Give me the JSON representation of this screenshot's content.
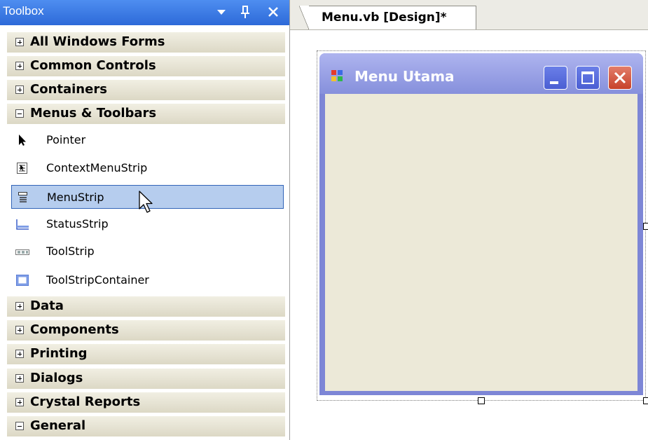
{
  "toolbox": {
    "title": "Toolbox",
    "buttons": {
      "dropdown": "▾",
      "pin": "ᵻ",
      "close": "✕"
    },
    "categories_top": [
      {
        "label": "All Windows Forms",
        "expanded": false
      },
      {
        "label": "Common Controls",
        "expanded": false
      },
      {
        "label": "Containers",
        "expanded": false
      },
      {
        "label": "Menus & Toolbars",
        "expanded": true
      }
    ],
    "items": [
      {
        "label": "Pointer",
        "icon": "pointer-icon"
      },
      {
        "label": "ContextMenuStrip",
        "icon": "contextmenustrip-icon"
      },
      {
        "label": "MenuStrip",
        "icon": "menustrip-icon",
        "selected": true
      },
      {
        "label": "StatusStrip",
        "icon": "statusstrip-icon"
      },
      {
        "label": "ToolStrip",
        "icon": "toolstrip-icon"
      },
      {
        "label": "ToolStripContainer",
        "icon": "toolstripcontainer-icon"
      }
    ],
    "categories_bottom": [
      {
        "label": "Data",
        "expanded": false
      },
      {
        "label": "Components",
        "expanded": false
      },
      {
        "label": "Printing",
        "expanded": false
      },
      {
        "label": "Dialogs",
        "expanded": false
      },
      {
        "label": "Crystal Reports",
        "expanded": false
      },
      {
        "label": "General",
        "expanded": true
      }
    ]
  },
  "editor": {
    "tab_label": "Menu.vb [Design]*"
  },
  "form": {
    "title": "Menu Utama"
  },
  "colors": {
    "toolbox_title_bg": "#2d69d8",
    "selection_bg": "#b6cdee",
    "form_frame": "#7d86d6",
    "form_client": "#ece9d8",
    "close_button": "#c7422a"
  }
}
